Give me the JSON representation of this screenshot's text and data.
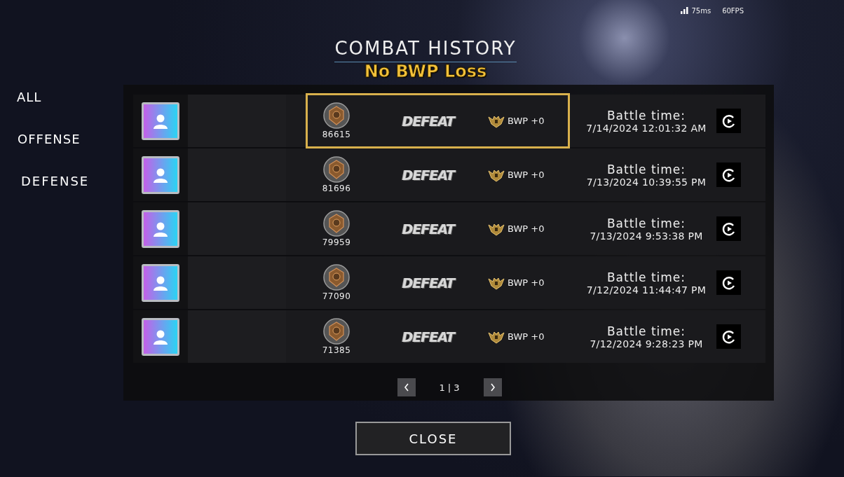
{
  "status": {
    "ping": "75ms",
    "fps": "60FPS"
  },
  "title": "COMBAT HISTORY",
  "notice": "No BWP Loss",
  "filters": [
    {
      "label": "ALL"
    },
    {
      "label": "OFFENSE"
    },
    {
      "label": "DEFENSE"
    }
  ],
  "rows": [
    {
      "score": "86615",
      "result": "DEFEAT",
      "bwp": "BWP +0",
      "time_label": "Battle time:",
      "time": "7/14/2024 12:01:32 AM",
      "highlighted": true
    },
    {
      "score": "81696",
      "result": "DEFEAT",
      "bwp": "BWP +0",
      "time_label": "Battle time:",
      "time": "7/13/2024 10:39:55 PM",
      "highlighted": false
    },
    {
      "score": "79959",
      "result": "DEFEAT",
      "bwp": "BWP +0",
      "time_label": "Battle time:",
      "time": "7/13/2024 9:53:38 PM",
      "highlighted": false
    },
    {
      "score": "77090",
      "result": "DEFEAT",
      "bwp": "BWP +0",
      "time_label": "Battle time:",
      "time": "7/12/2024 11:44:47 PM",
      "highlighted": false
    },
    {
      "score": "71385",
      "result": "DEFEAT",
      "bwp": "BWP +0",
      "time_label": "Battle time:",
      "time": "7/12/2024 9:28:23 PM",
      "highlighted": false
    }
  ],
  "pager": {
    "label": "1 | 3"
  },
  "close_button": "CLOSE"
}
